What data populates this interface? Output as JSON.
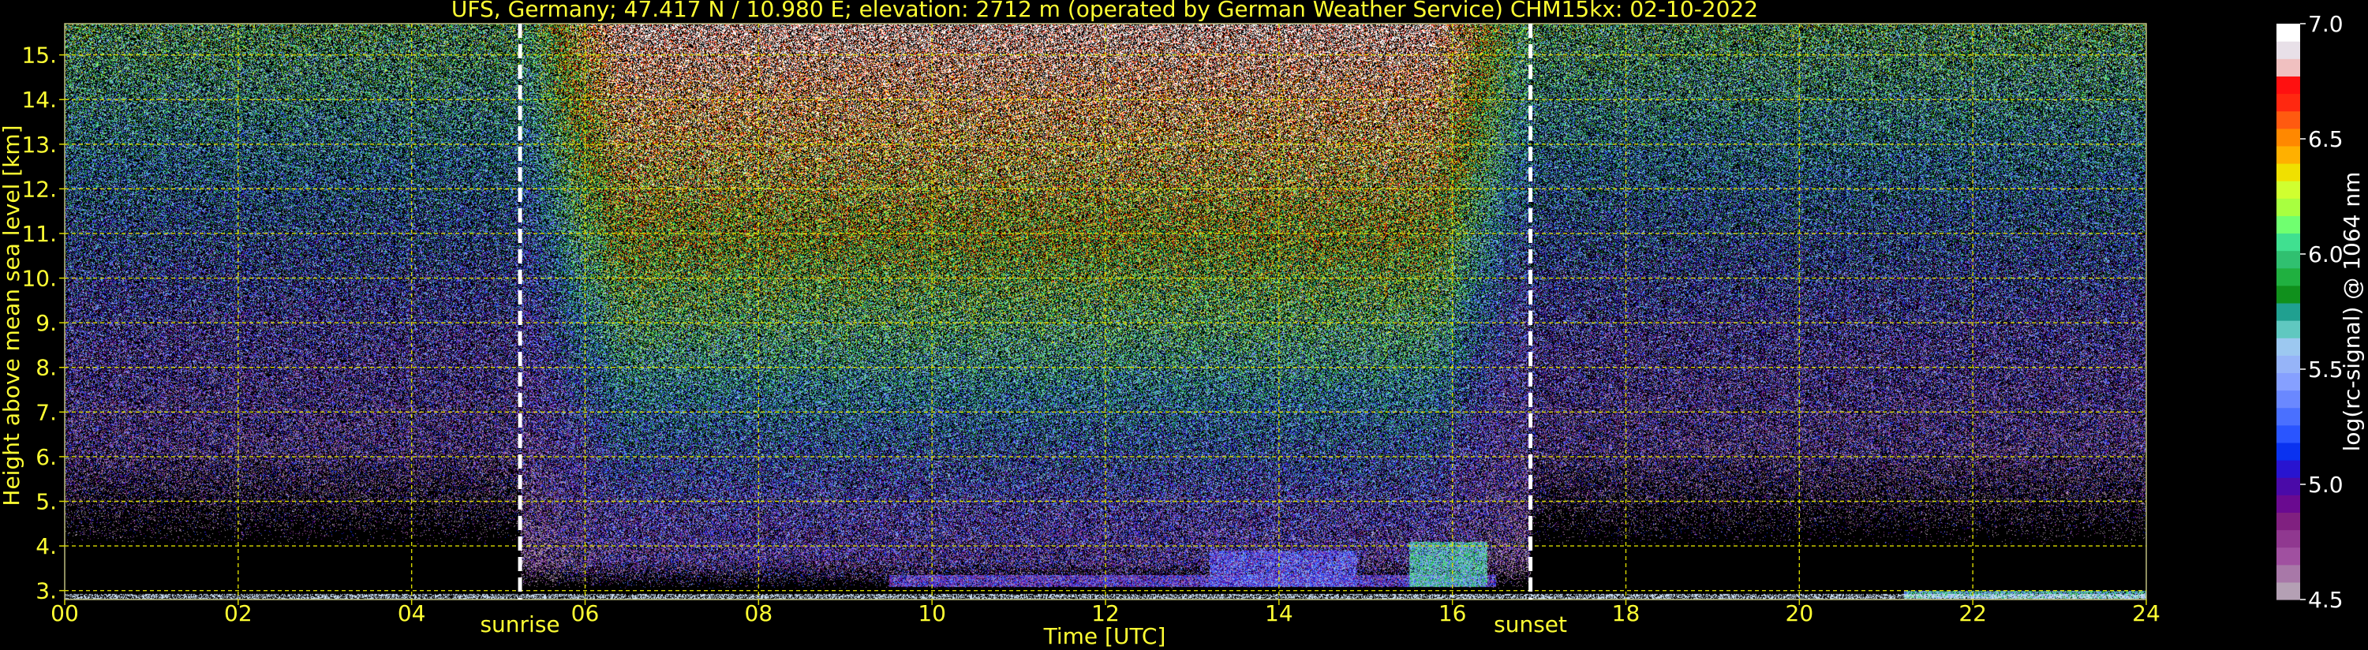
{
  "chart_data": {
    "type": "heatmap",
    "title": "UFS, Germany; 47.417 N / 10.980 E; elevation: 2712 m  (operated by German Weather Service)     CHM15kx: 02-10-2022",
    "xlabel": "Time [UTC]",
    "ylabel": "Height above mean sea level [km]",
    "xlim": [
      0,
      24
    ],
    "ylim": [
      2.8,
      15.7
    ],
    "x_ticks": [
      {
        "v": 0,
        "label": "00"
      },
      {
        "v": 2,
        "label": "02"
      },
      {
        "v": 4,
        "label": "04"
      },
      {
        "v": 6,
        "label": "06"
      },
      {
        "v": 8,
        "label": "08"
      },
      {
        "v": 10,
        "label": "10"
      },
      {
        "v": 12,
        "label": "12"
      },
      {
        "v": 14,
        "label": "14"
      },
      {
        "v": 16,
        "label": "16"
      },
      {
        "v": 18,
        "label": "18"
      },
      {
        "v": 20,
        "label": "20"
      },
      {
        "v": 22,
        "label": "22"
      },
      {
        "v": 24,
        "label": "24"
      }
    ],
    "y_ticks": [
      {
        "v": 3,
        "label": "3."
      },
      {
        "v": 4,
        "label": "4."
      },
      {
        "v": 5,
        "label": "5."
      },
      {
        "v": 6,
        "label": "6."
      },
      {
        "v": 7,
        "label": "7."
      },
      {
        "v": 8,
        "label": "8."
      },
      {
        "v": 9,
        "label": "9."
      },
      {
        "v": 10,
        "label": "10."
      },
      {
        "v": 11,
        "label": "11."
      },
      {
        "v": 12,
        "label": "12."
      },
      {
        "v": 13,
        "label": "13."
      },
      {
        "v": 14,
        "label": "14."
      },
      {
        "v": 15,
        "label": "15."
      }
    ],
    "grid": true,
    "annotations": [
      {
        "x": 5.25,
        "label": "sunrise"
      },
      {
        "x": 16.9,
        "label": "sunset"
      }
    ],
    "colorbar": {
      "label": "log(rc-signal) @ 1064 nm",
      "range": [
        4.5,
        7.0
      ],
      "ticks": [
        {
          "v": 4.5,
          "label": "4.5"
        },
        {
          "v": 5.0,
          "label": "5.0"
        },
        {
          "v": 5.5,
          "label": "5.5"
        },
        {
          "v": 6.0,
          "label": "6.0"
        },
        {
          "v": 6.5,
          "label": "6.5"
        },
        {
          "v": 7.0,
          "label": "7.0"
        }
      ],
      "colors": [
        "#b4a0b4",
        "#a878a8",
        "#a050a0",
        "#903890",
        "#802080",
        "#6a0a90",
        "#4a0aa8",
        "#2814d0",
        "#0a32f0",
        "#2a55ff",
        "#4a70ff",
        "#6a88ff",
        "#86a0ff",
        "#96b4f8",
        "#9cc8f0",
        "#60c8c0",
        "#20a090",
        "#10901c",
        "#20b040",
        "#30c070",
        "#40e090",
        "#70ff70",
        "#a8ff40",
        "#d0ff30",
        "#f0e000",
        "#ffb000",
        "#ff8800",
        "#ff5a10",
        "#ff2810",
        "#ff1010",
        "#f0c0c0",
        "#e8e0e8",
        "#ffffff"
      ]
    },
    "features": [
      {
        "feature": "layer",
        "x_range": [
          9.5,
          16.5
        ],
        "y_range": [
          3.1,
          3.35
        ],
        "value": 5.0
      },
      {
        "feature": "layer",
        "x_range": [
          13.2,
          14.9
        ],
        "y_range": [
          3.1,
          3.9
        ],
        "value": 5.2
      },
      {
        "feature": "layer",
        "x_range": [
          15.5,
          16.4
        ],
        "y_range": [
          3.1,
          4.1
        ],
        "value": 5.7
      },
      {
        "feature": "layer",
        "x_range": [
          21.2,
          24
        ],
        "y_range": [
          2.82,
          3.0
        ],
        "value": 5.7
      }
    ]
  }
}
